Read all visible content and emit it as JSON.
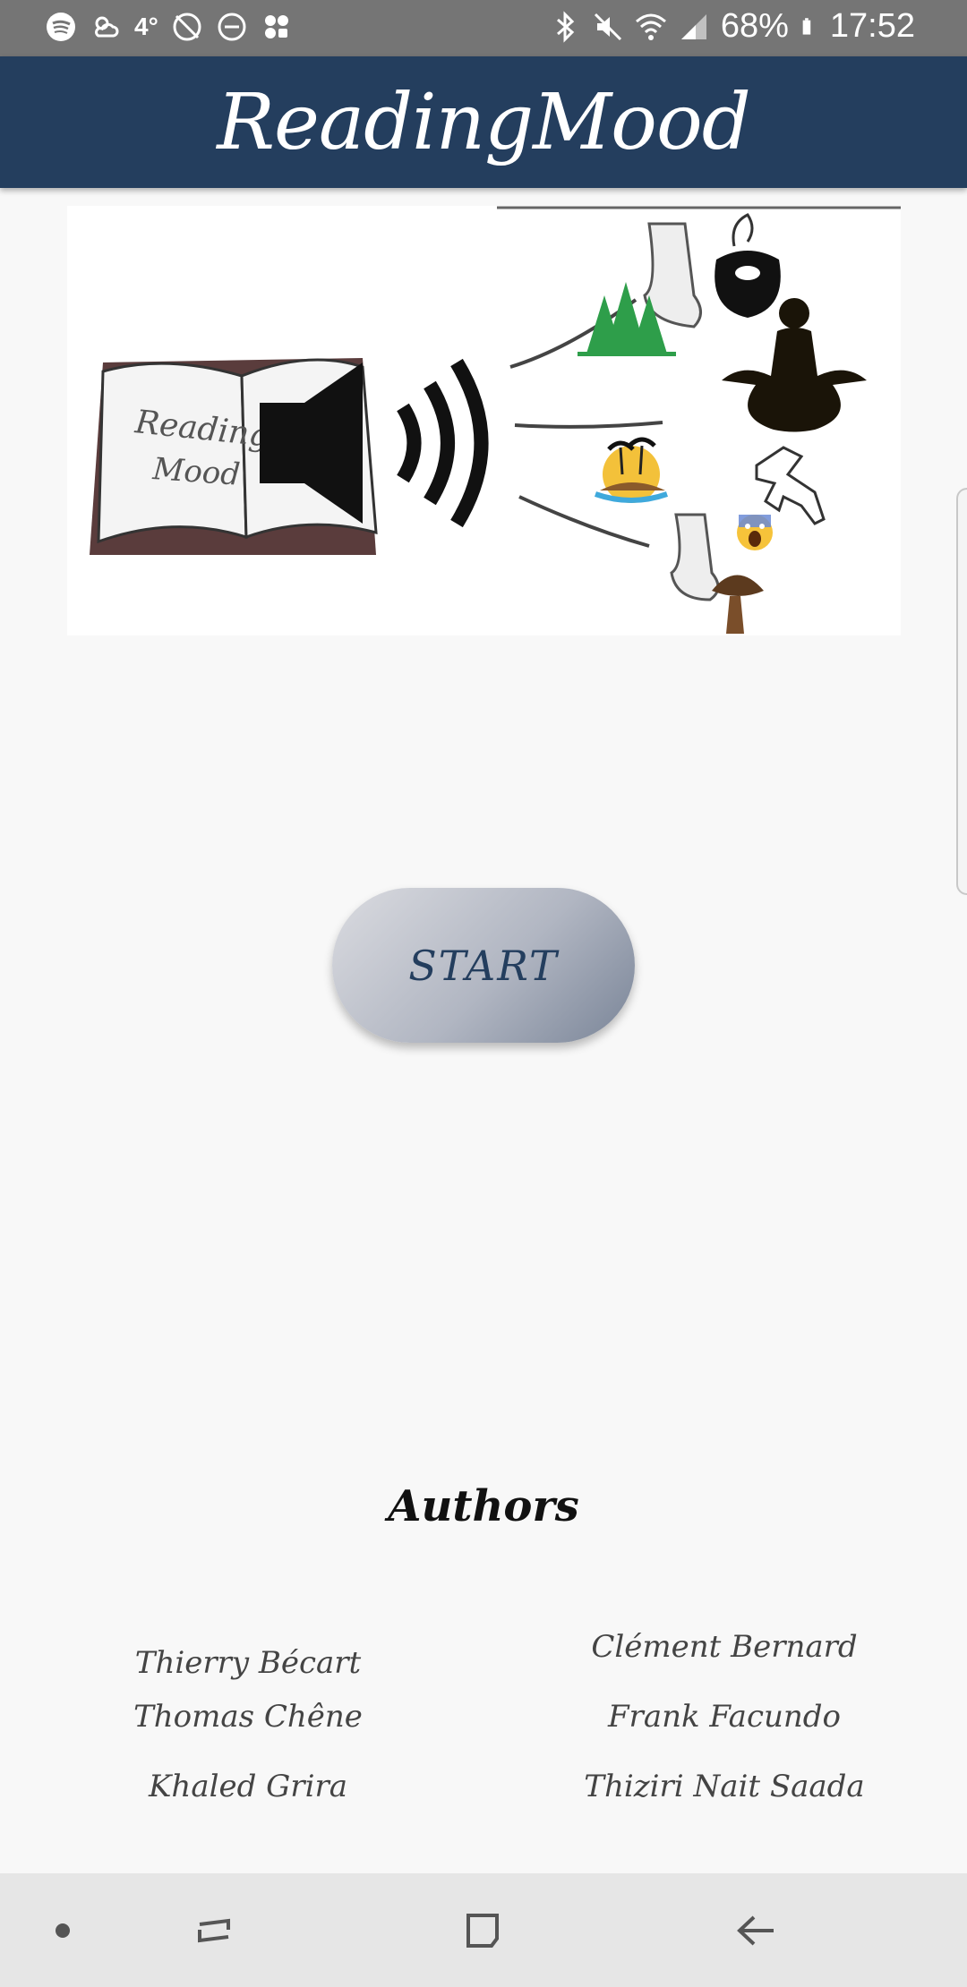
{
  "status_bar": {
    "battery": "68%",
    "time": "17:52",
    "temperature": "4°",
    "left_icons": [
      "spotify-icon",
      "weather-icon",
      "temperature-icon",
      "no-location-icon",
      "do-not-disturb-icon",
      "apps-icon"
    ],
    "right_icons": [
      "bluetooth-icon",
      "mute-icon",
      "wifi-icon",
      "signal-icon",
      "battery-icon"
    ]
  },
  "app_bar": {
    "title": "ReadingMood"
  },
  "banner": {
    "book_text_line1": "Reading",
    "book_text_line2": "Mood",
    "icons": [
      "book-icon",
      "speaker-icon",
      "sound-waves-icon",
      "nose-icon",
      "cauldron-icon",
      "meditation-icon",
      "trees-icon",
      "island-icon",
      "crime-scene-outline-icon",
      "scared-emoji-icon",
      "mushroom-icon"
    ]
  },
  "start_button": {
    "label": "START"
  },
  "authors": {
    "title": "Authors",
    "names": [
      "Thierry Bécart",
      "Clément Bernard",
      "Thomas Chêne",
      "Frank Facundo",
      "Khaled Grira",
      "Thiziri Nait Saada"
    ]
  },
  "nav_bar": {
    "items": [
      "dot-icon",
      "recent-apps-icon",
      "home-icon",
      "back-icon"
    ]
  },
  "colors": {
    "app_bar": "#243e5e",
    "status_bar": "#757575",
    "nav_bar": "#e6e6e6",
    "background": "#f8f8f8",
    "accent_text": "#243e5e"
  }
}
